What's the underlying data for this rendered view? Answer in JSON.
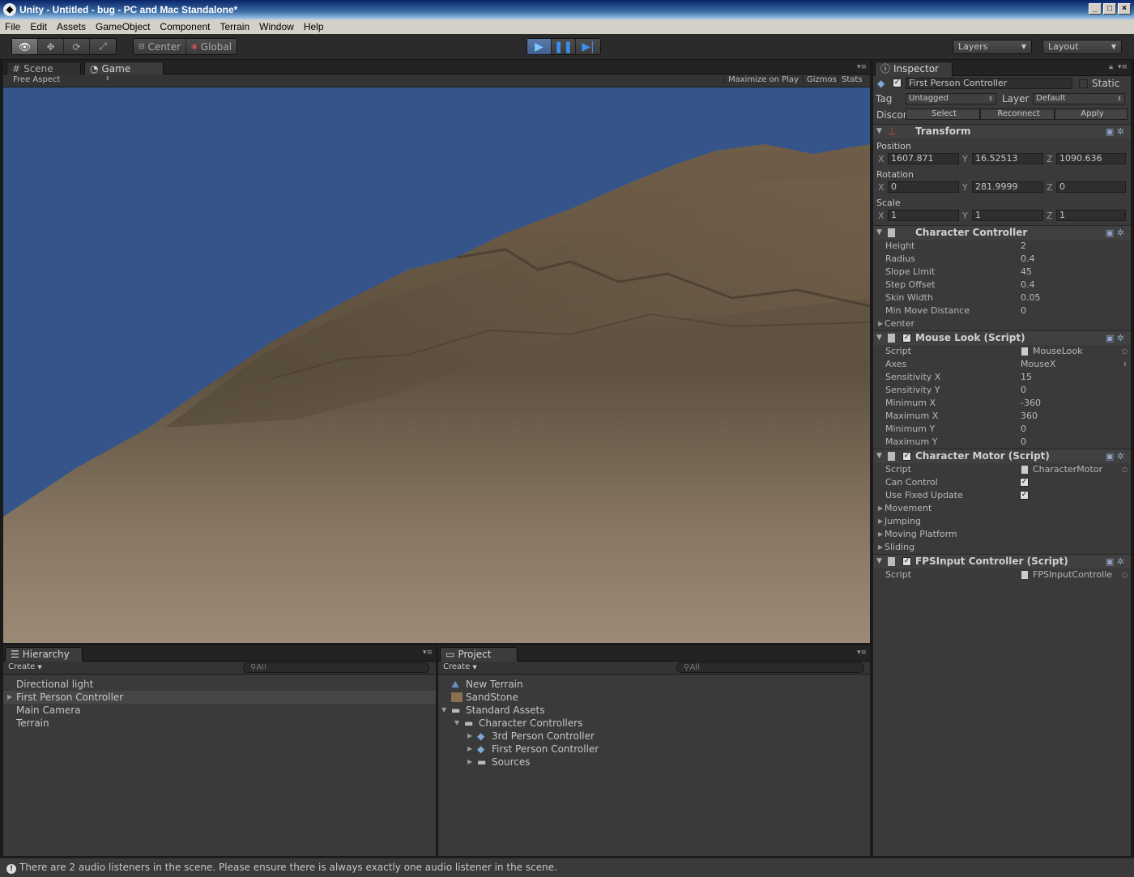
{
  "window": {
    "title": "Unity - Untitled - bug - PC and Mac Standalone*"
  },
  "menu": [
    "File",
    "Edit",
    "Assets",
    "GameObject",
    "Component",
    "Terrain",
    "Window",
    "Help"
  ],
  "toolbar": {
    "center_label": "Center",
    "global_label": "Global",
    "layers_label": "Layers",
    "layout_label": "Layout"
  },
  "game_panel": {
    "tabs": [
      "Scene",
      "Game"
    ],
    "aspect": "Free Aspect",
    "maximize_on_play": "Maximize on Play",
    "gizmos": "Gizmos",
    "stats": "Stats"
  },
  "hierarchy": {
    "tab": "Hierarchy",
    "create": "Create",
    "search_placeholder": "All",
    "items": [
      "Directional light",
      "First Person Controller",
      "Main Camera",
      "Terrain"
    ]
  },
  "project": {
    "tab": "Project",
    "create": "Create",
    "search_placeholder": "All",
    "items": [
      "New Terrain",
      "SandStone",
      "Standard Assets",
      "Character Controllers",
      "3rd Person Controller",
      "First Person Controller",
      "Sources"
    ]
  },
  "inspector": {
    "tab": "Inspector",
    "object_name": "First Person Controller",
    "static_label": "Static",
    "tag_label": "Tag",
    "tag_value": "Untagged",
    "layer_label": "Layer",
    "layer_value": "Default",
    "prefab_label": "Discor",
    "select": "Select",
    "reconnect": "Reconnect",
    "apply": "Apply",
    "transform": {
      "title": "Transform",
      "position_label": "Position",
      "position": {
        "x": "1607.871",
        "y": "16.52513",
        "z": "1090.636"
      },
      "rotation_label": "Rotation",
      "rotation": {
        "x": "0",
        "y": "281.9999",
        "z": "0"
      },
      "scale_label": "Scale",
      "scale": {
        "x": "1",
        "y": "1",
        "z": "1"
      },
      "axis_x": "X",
      "axis_y": "Y",
      "axis_z": "Z"
    },
    "character_controller": {
      "title": "Character Controller",
      "props": [
        {
          "label": "Height",
          "value": "2"
        },
        {
          "label": "Radius",
          "value": "0.4"
        },
        {
          "label": "Slope Limit",
          "value": "45"
        },
        {
          "label": "Step Offset",
          "value": "0.4"
        },
        {
          "label": "Skin Width",
          "value": "0.05"
        },
        {
          "label": "Min Move Distance",
          "value": "0"
        }
      ],
      "center": "Center"
    },
    "mouse_look": {
      "title": "Mouse Look (Script)",
      "props": [
        {
          "label": "Script",
          "value": "MouseLook"
        },
        {
          "label": "Axes",
          "value": "MouseX"
        },
        {
          "label": "Sensitivity X",
          "value": "15"
        },
        {
          "label": "Sensitivity Y",
          "value": "0"
        },
        {
          "label": "Minimum X",
          "value": "-360"
        },
        {
          "label": "Maximum X",
          "value": "360"
        },
        {
          "label": "Minimum Y",
          "value": "0"
        },
        {
          "label": "Maximum Y",
          "value": "0"
        }
      ]
    },
    "character_motor": {
      "title": "Character Motor (Script)",
      "script_label": "Script",
      "script_value": "CharacterMotor",
      "can_control": "Can Control",
      "use_fixed_update": "Use Fixed Update",
      "folds": [
        "Movement",
        "Jumping",
        "Moving Platform",
        "Sliding"
      ]
    },
    "fps_input": {
      "title": "FPSInput Controller (Script)",
      "script_label": "Script",
      "script_value": "FPSInputControlle"
    }
  },
  "status": "There are 2 audio listeners in the scene. Please ensure there is always exactly one audio listener in the scene.",
  "colors": {
    "sky": "#35558a",
    "terrain": "#6b5a46",
    "accent": "#3c8df0"
  }
}
